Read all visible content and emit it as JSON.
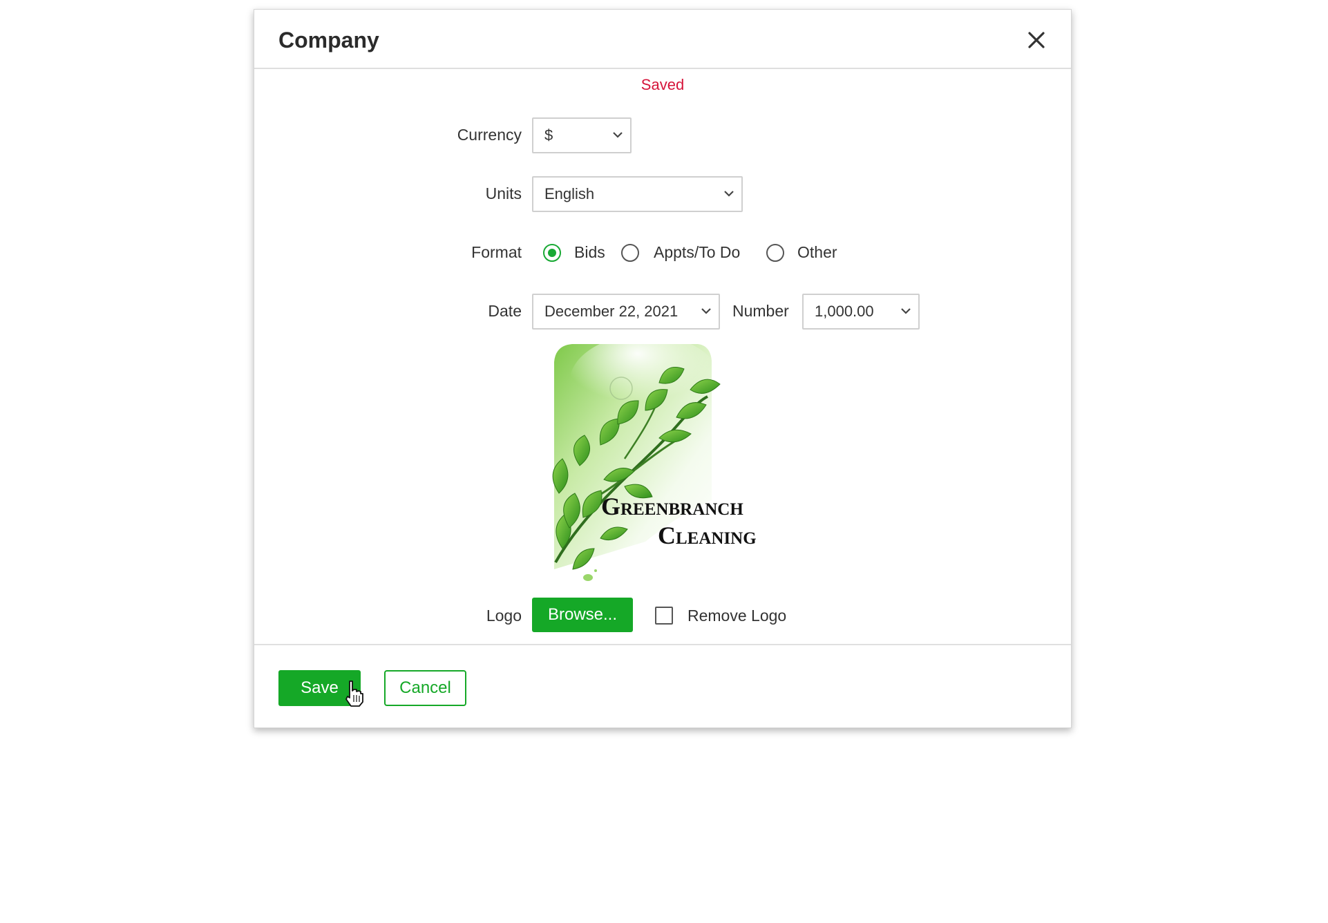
{
  "dialog": {
    "title": "Company",
    "status": "Saved",
    "currency": {
      "label": "Currency",
      "value": "$"
    },
    "units": {
      "label": "Units",
      "value": "English"
    },
    "format": {
      "label": "Format",
      "options": [
        {
          "label": "Bids",
          "checked": true
        },
        {
          "label": "Appts/To Do",
          "checked": false
        },
        {
          "label": "Other",
          "checked": false
        }
      ]
    },
    "date": {
      "label": "Date",
      "value": "December 22, 2021"
    },
    "number": {
      "label": "Number",
      "value": "1,000.00"
    },
    "logo": {
      "label": "Logo",
      "brand_line1": "Greenbranch",
      "brand_line2": "Cleaning",
      "browse_label": "Browse...",
      "remove_label": "Remove Logo"
    },
    "footer": {
      "save_label": "Save",
      "cancel_label": "Cancel"
    }
  },
  "colors": {
    "accent_green": "#15a827",
    "status_red": "#d6143a"
  }
}
